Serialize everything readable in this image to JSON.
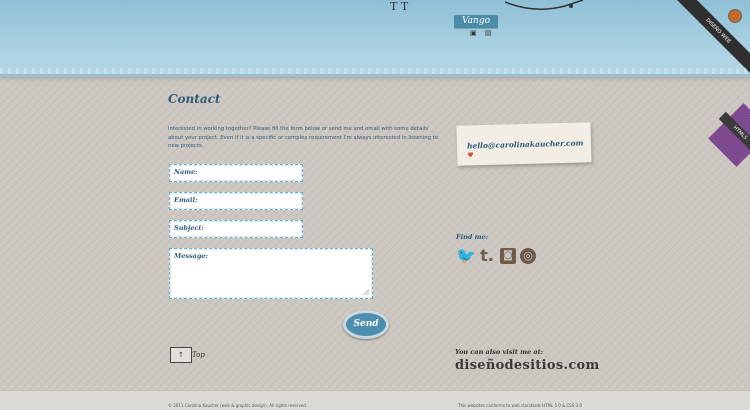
{
  "header": {
    "sketch_text": "T T",
    "badge_label": "Vango",
    "mini_icons": "▣ ▤",
    "ribbon_corner": "DISEÑO WEB",
    "ribbon_side": "CSS3",
    "ribbon_side2": "HTML5"
  },
  "contact": {
    "title": "Contact",
    "intro": "Interested in working together? Please fill the form below or send me and email with some details about your project. Even if it is a specific or complex requirement I'm always interested in listening to new projects.",
    "fields": {
      "name_label": "Name:",
      "email_label": "Email:",
      "subject_label": "Subject:",
      "message_label": "Message:"
    },
    "send_label": "Send",
    "top_label": "Top",
    "top_arrow": "↑"
  },
  "sidebar": {
    "email": "hello@carolinakaucher.com",
    "heart": "♥",
    "find_me_label": "Find me:",
    "social": {
      "twitter": "🐦",
      "tumblr": "t.",
      "rss": "◙",
      "dribbble": "◎"
    },
    "visit_label": "You can also visit me at:",
    "visit_site": "diseñodesitios.com"
  },
  "footer": {
    "copyright": "© 2011 Carolina Kaucher (web & graphic design). All rights reserved.",
    "validation": "This websites conforms to web standards HTML 5.0 & CSS 3.0"
  }
}
